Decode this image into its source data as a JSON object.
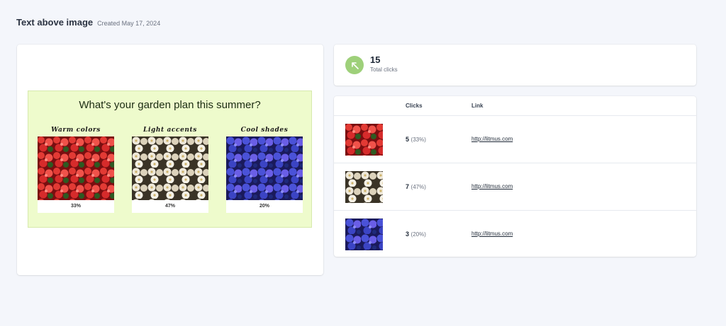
{
  "page": {
    "title": "Text above image",
    "created": "Created May 17, 2024"
  },
  "preview": {
    "question": "What's your garden plan this summer?",
    "options": [
      {
        "label": "Warm colors",
        "percent": "33%"
      },
      {
        "label": "Light accents",
        "percent": "47%"
      },
      {
        "label": "Cool shades",
        "percent": "20%"
      }
    ]
  },
  "summary": {
    "total": "15",
    "label": "Total clicks",
    "icon": "cursor-click-icon"
  },
  "table": {
    "headers": {
      "image": "",
      "clicks": "Clicks",
      "link": "Link"
    },
    "rows": [
      {
        "clicks": "5",
        "percent": "(33%)",
        "link": "http://litmus.com"
      },
      {
        "clicks": "7",
        "percent": "(47%)",
        "link": "http://litmus.com"
      },
      {
        "clicks": "3",
        "percent": "(20%)",
        "link": "http://litmus.com"
      }
    ]
  },
  "colors": {
    "background": "#f4f6fb",
    "email_bg": "#eefbcc",
    "icon_green": "#9ed07a"
  }
}
